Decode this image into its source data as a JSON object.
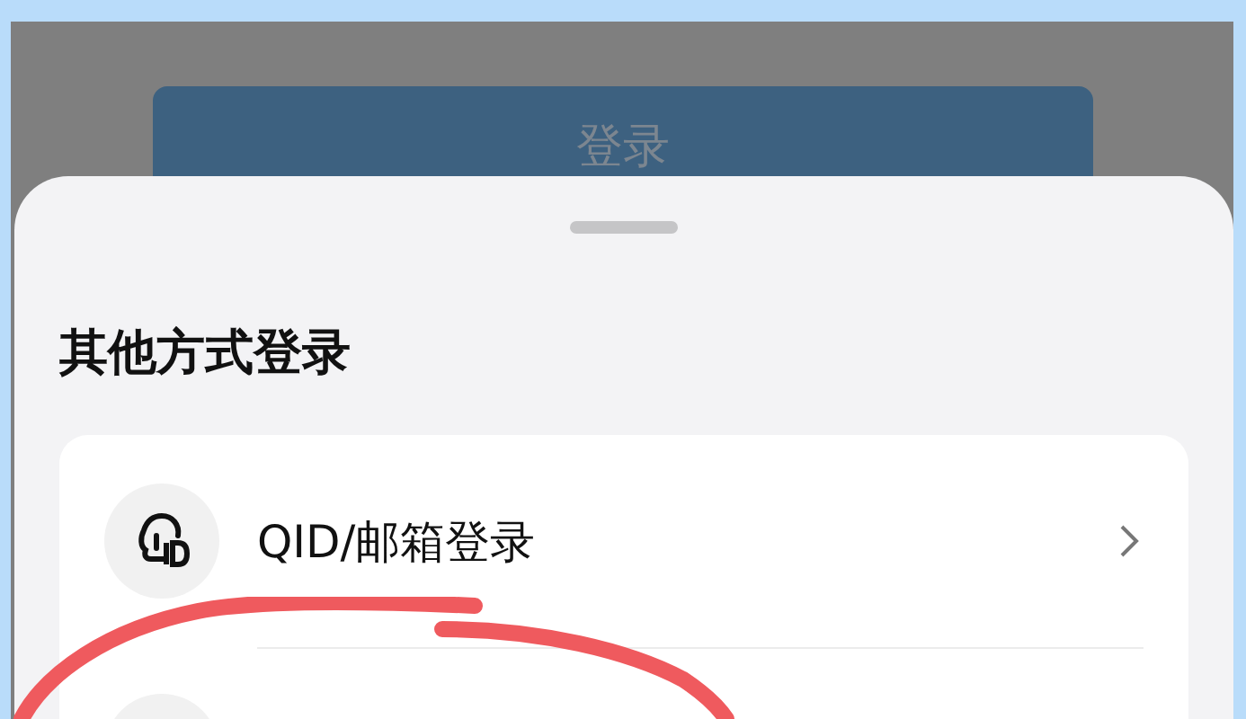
{
  "background_button": {
    "label": "登录"
  },
  "sheet": {
    "title": "其他方式登录",
    "options": [
      {
        "label": "QID/邮箱登录"
      }
    ]
  }
}
